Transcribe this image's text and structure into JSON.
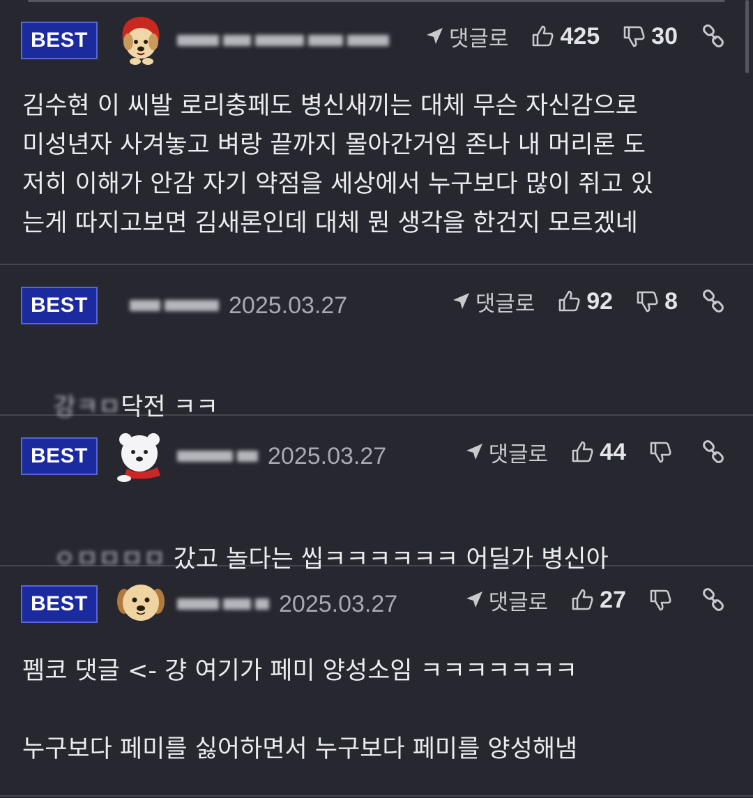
{
  "comments": [
    {
      "badge": "BEST",
      "date": "",
      "reply_label": "댓글로",
      "likes": "425",
      "dislikes": "30",
      "avatar": "puppy-red-hood-icon",
      "body": "김수현 이 씨발 로리충페도 병신새끼는 대체 무슨 자신감으로\n미성년자 사겨놓고 벼랑 끝까지 몰아간거임 존나 내 머리론 도\n저히 이해가 안감 자기 약점을 세상에서 누구보다 많이 쥐고 있\n는게 따지고보면 김새론인데 대체 뭔 생각을 한건지 모르겠네"
    },
    {
      "badge": "BEST",
      "date": "2025.03.27",
      "reply_label": "댓글로",
      "likes": "92",
      "dislikes": "8",
      "avatar": "",
      "body": "닥전 ㅋㅋ"
    },
    {
      "badge": "BEST",
      "date": "2025.03.27",
      "reply_label": "댓글로",
      "likes": "44",
      "dislikes": "",
      "avatar": "polar-bear-icon",
      "body": "갔고 놀다는 씹ㅋㅋㅋㅋㅋㅋ 어딜가 병신아"
    },
    {
      "badge": "BEST",
      "date": "2025.03.27",
      "reply_label": "댓글로",
      "likes": "27",
      "dislikes": "",
      "avatar": "puppy-face-icon",
      "body": "펨코 댓글 <- 걍 여기가 페미 양성소임 ㅋㅋㅋㅋㅋㅋㅋ\n\n누구보다 페미를 싫어하면서 누구보다 페미를 양성해냄"
    }
  ],
  "colors": {
    "background": "#26272f",
    "badge": "#1c2aa0",
    "divider": "#45464e"
  }
}
